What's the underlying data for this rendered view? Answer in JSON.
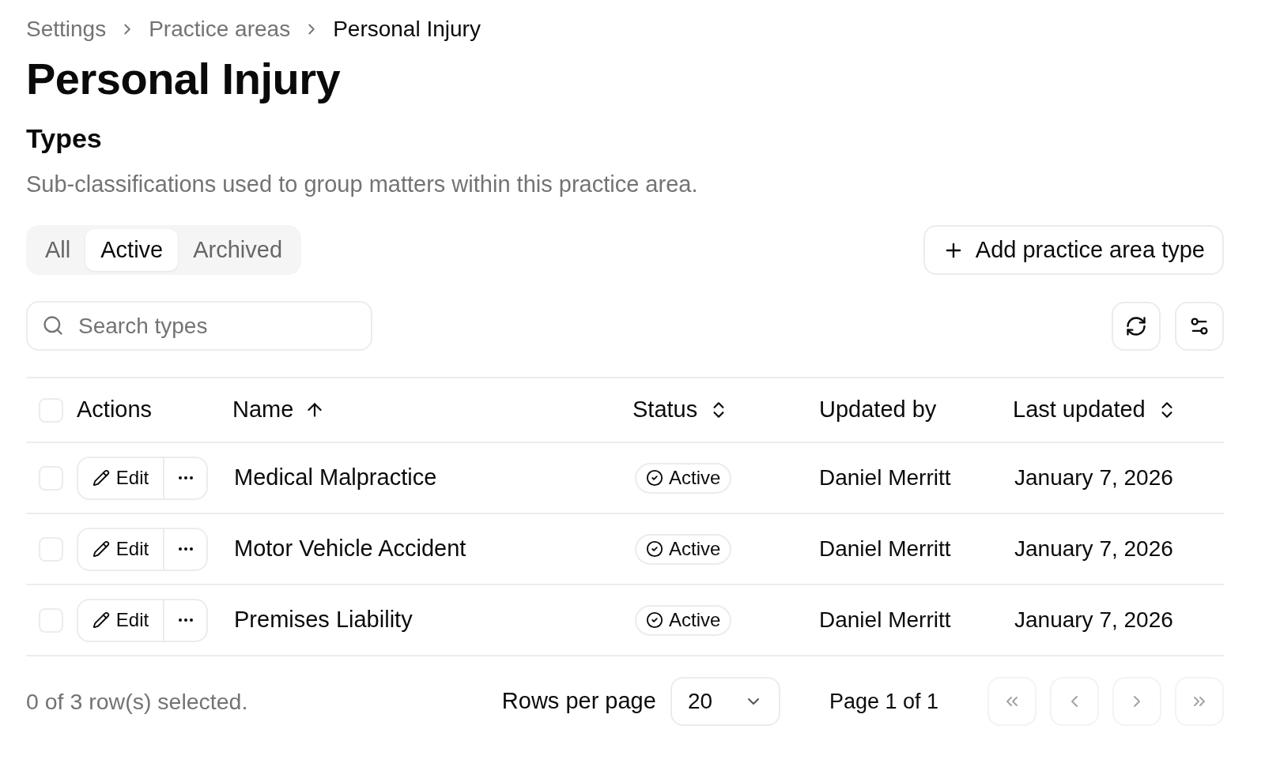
{
  "breadcrumb": [
    {
      "label": "Settings",
      "current": false
    },
    {
      "label": "Practice areas",
      "current": false
    },
    {
      "label": "Personal Injury",
      "current": true
    }
  ],
  "title": "Personal Injury",
  "section": {
    "title": "Types",
    "description": "Sub-classifications used to group matters within this practice area."
  },
  "filter_tabs": [
    {
      "label": "All",
      "selected": false
    },
    {
      "label": "Active",
      "selected": true
    },
    {
      "label": "Archived",
      "selected": false
    }
  ],
  "add_button": {
    "label": "Add practice area type"
  },
  "search": {
    "placeholder": "Search types"
  },
  "table": {
    "select_all_checked": false,
    "columns": [
      {
        "label": "Actions"
      },
      {
        "label": "Name",
        "sortable": true,
        "sorted_ascending": true
      },
      {
        "label": "Status",
        "sortable": true,
        "sorted_ascending": false
      },
      {
        "label": "Updated by"
      },
      {
        "label": "Last updated",
        "sortable": true,
        "sorted_ascending": false
      }
    ],
    "rows": [
      {
        "checked": false,
        "edit_label": "Edit",
        "name": "Medical Malpractice",
        "status": "Active",
        "updated_by": "Daniel Merritt",
        "last_updated": "January 7, 2026"
      },
      {
        "checked": false,
        "edit_label": "Edit",
        "name": "Motor Vehicle Accident",
        "status": "Active",
        "updated_by": "Daniel Merritt",
        "last_updated": "January 7, 2026"
      },
      {
        "checked": false,
        "edit_label": "Edit",
        "name": "Premises Liability",
        "status": "Active",
        "updated_by": "Daniel Merritt",
        "last_updated": "January 7, 2026"
      }
    ]
  },
  "pagination": {
    "selection_text": "0 of 3 row(s) selected.",
    "rows_per_page_label": "Rows per page",
    "rows_per_page_value": "20",
    "page_text": "Page 1 of 1",
    "nav_buttons": [
      {
        "kind": "first",
        "disabled": true
      },
      {
        "kind": "previous",
        "disabled": true
      },
      {
        "kind": "next",
        "disabled": true
      },
      {
        "kind": "last",
        "disabled": true
      }
    ]
  }
}
